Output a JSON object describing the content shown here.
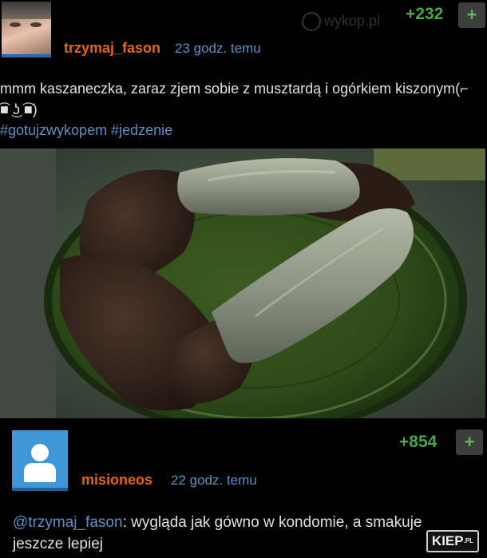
{
  "post": {
    "username": "trzymaj_fason",
    "time": "23 godz. temu",
    "score": "+232",
    "plus_label": "+",
    "watermark": "wykop.pl",
    "text": "mmm kaszaneczka, zaraz zjem sobie z musztardą i ogórkiem kiszonym(⌐ ͡■ ͜ʖ ͡■)",
    "tags": [
      "#gotujzwykopem",
      "#jedzenie"
    ]
  },
  "comment": {
    "username": "misioneos",
    "time": "22 godz. temu",
    "score": "+854",
    "plus_label": "+",
    "mention": "@trzymaj_fason",
    "text": ": wygląda jak gówno w kondomie, a smakuje jeszcze lepiej"
  },
  "badge": {
    "text": "KIEP",
    "suffix": ".PL"
  },
  "colors": {
    "username": "#e56317",
    "link": "#5d8fc4",
    "score": "#4aa64a",
    "background": "#000000"
  },
  "icons": {
    "plus": "plus-icon",
    "anon_avatar": "user-silhouette-icon"
  }
}
